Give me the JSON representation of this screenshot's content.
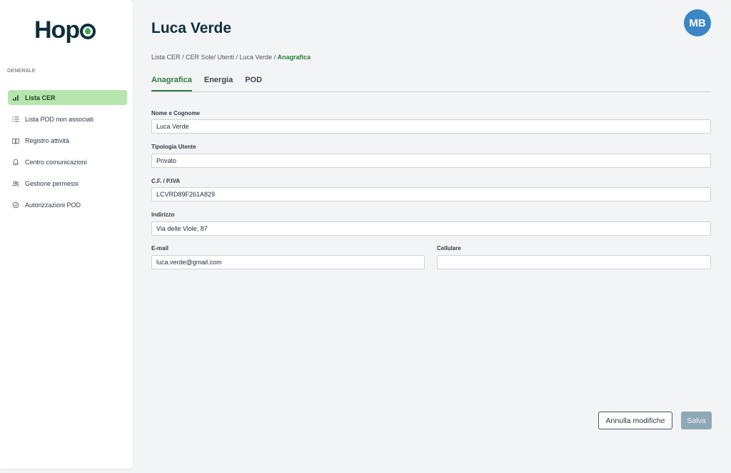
{
  "brand": {
    "logo_text": "Hop",
    "logo_accent": "#3aa84a"
  },
  "sidebar": {
    "section_label": "GENERALE",
    "items": [
      {
        "label": "Lista CER",
        "icon": "bar-chart-icon",
        "active": true
      },
      {
        "label": "Lista POD non associati",
        "icon": "list-icon",
        "active": false
      },
      {
        "label": "Registro attività",
        "icon": "book-icon",
        "active": false
      },
      {
        "label": "Centro comunicazioni",
        "icon": "bell-icon",
        "active": false
      },
      {
        "label": "Gestione permessi",
        "icon": "users-icon",
        "active": false
      },
      {
        "label": "Autorizzazioni POD",
        "icon": "check-circle-icon",
        "active": false
      }
    ]
  },
  "header": {
    "title": "Luca Verde",
    "avatar_initials": "MB"
  },
  "breadcrumb": {
    "path": "Lista CER / CER Sole/ Utenti / Luca Verde / ",
    "current": "Anagrafica"
  },
  "tabs": [
    {
      "label": "Anagrafica",
      "active": true
    },
    {
      "label": "Energia",
      "active": false
    },
    {
      "label": "POD",
      "active": false
    }
  ],
  "form": {
    "name": {
      "label": "Nome e Cognome",
      "value": "Luca Verde"
    },
    "user_type": {
      "label": "Tipologia Utente",
      "value": "Privato"
    },
    "tax_id": {
      "label": "C.F. / P.IVA",
      "value": "LCVRD89F261A829"
    },
    "address": {
      "label": "Indirizzo",
      "value": "Via delle Viole, 87"
    },
    "email": {
      "label": "E-mail",
      "value": "luca.verde@gmail.com"
    },
    "mobile": {
      "label": "Cellulare",
      "value": ""
    }
  },
  "actions": {
    "cancel_label": "Annulla modifiche",
    "save_label": "Salva"
  },
  "colors": {
    "accent_green": "#2f7a3a",
    "active_nav_bg": "#b7e5ae",
    "avatar_bg": "#3b86c4",
    "save_disabled_bg": "#8fa8b8"
  }
}
